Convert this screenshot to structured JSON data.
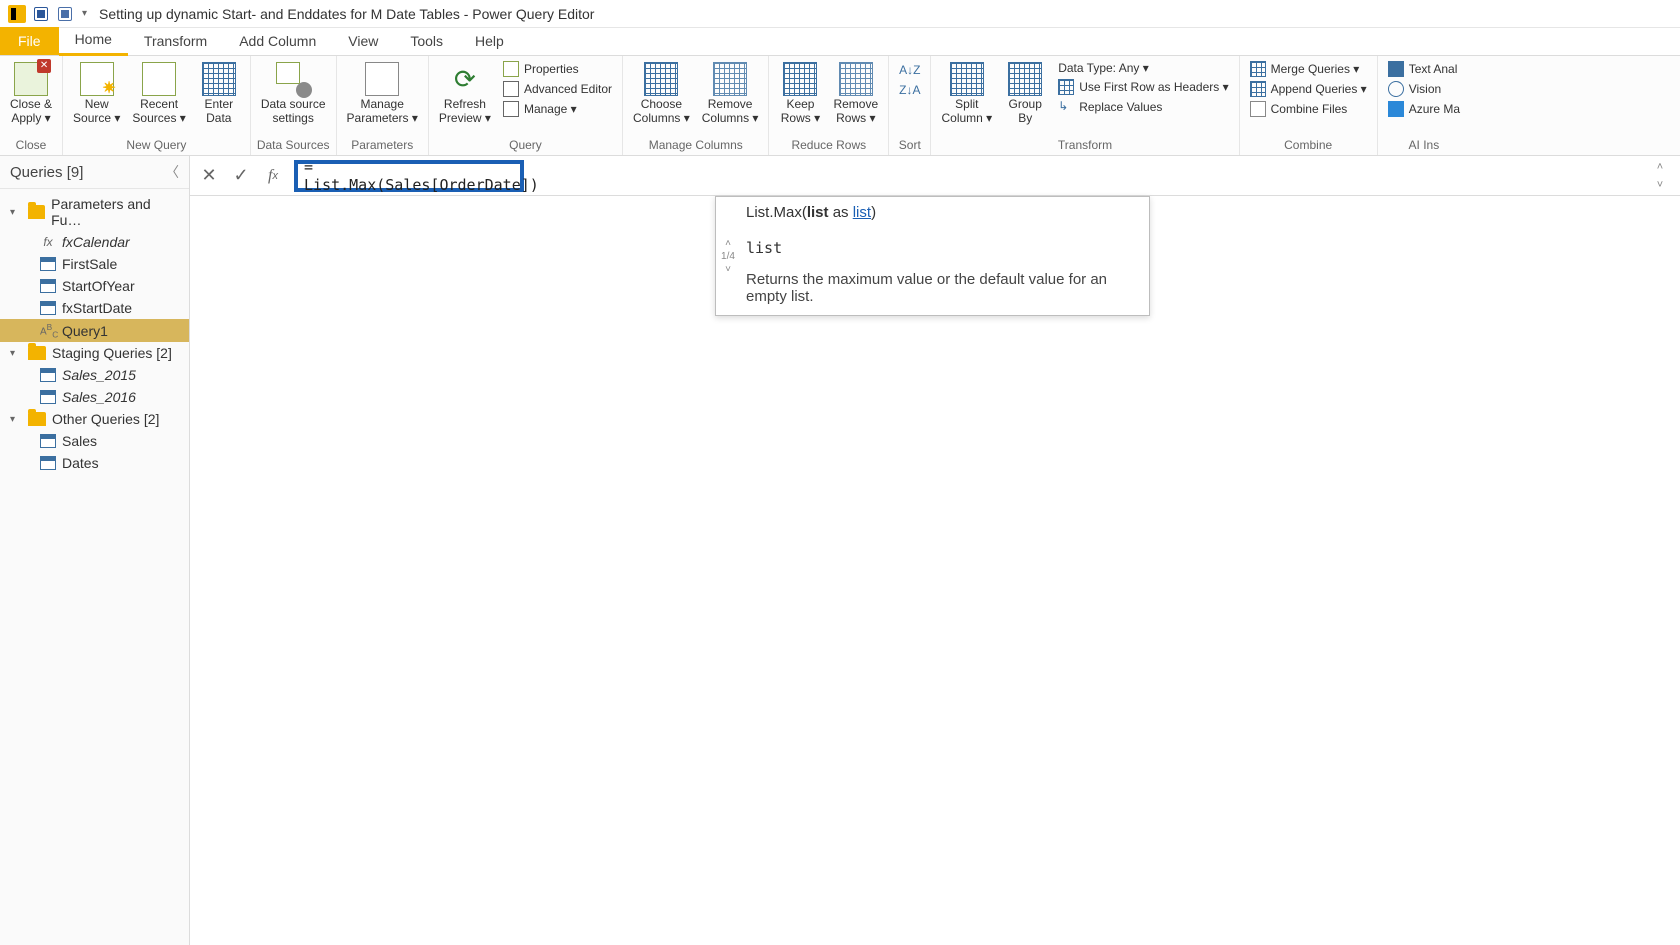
{
  "titlebar": {
    "title": "Setting up dynamic Start- and Enddates for M Date Tables - Power Query Editor"
  },
  "menu": {
    "file": "File",
    "home": "Home",
    "transform": "Transform",
    "add_column": "Add Column",
    "view": "View",
    "tools": "Tools",
    "help": "Help"
  },
  "ribbon": {
    "close": {
      "close_apply": "Close &\nApply ▾",
      "group": "Close"
    },
    "newquery": {
      "new_source": "New\nSource ▾",
      "recent_sources": "Recent\nSources ▾",
      "enter_data": "Enter\nData",
      "group": "New Query"
    },
    "datasources": {
      "settings": "Data source\nsettings",
      "group": "Data Sources"
    },
    "parameters": {
      "manage": "Manage\nParameters ▾",
      "group": "Parameters"
    },
    "query": {
      "refresh": "Refresh\nPreview ▾",
      "properties": "Properties",
      "advanced": "Advanced Editor",
      "manage": "Manage ▾",
      "group": "Query"
    },
    "managecols": {
      "choose": "Choose\nColumns ▾",
      "remove": "Remove\nColumns ▾",
      "group": "Manage Columns"
    },
    "reducerows": {
      "keep": "Keep\nRows ▾",
      "remove": "Remove\nRows ▾",
      "group": "Reduce Rows"
    },
    "sort": {
      "group": "Sort"
    },
    "transform": {
      "split": "Split\nColumn ▾",
      "groupby": "Group\nBy",
      "datatype": "Data Type: Any ▾",
      "firstrow": "Use First Row as Headers ▾",
      "replace": "Replace Values",
      "group": "Transform"
    },
    "combine": {
      "merge": "Merge Queries ▾",
      "append": "Append Queries ▾",
      "combine": "Combine Files",
      "group": "Combine"
    },
    "ai": {
      "text": "Text Anal",
      "vision": "Vision",
      "azure": "Azure Ma",
      "group": "AI Ins"
    }
  },
  "queriesPanel": {
    "header": "Queries [9]",
    "group_params": "Parameters and Fu…",
    "fxCalendar": "fxCalendar",
    "FirstSale": "FirstSale",
    "StartOfYear": "StartOfYear",
    "fxStartDate": "fxStartDate",
    "Query1": "Query1",
    "group_staging": "Staging Queries [2]",
    "Sales_2015": "Sales_2015",
    "Sales_2016": "Sales_2016",
    "group_other": "Other Queries [2]",
    "Sales": "Sales",
    "Dates": "Dates"
  },
  "formula": {
    "text": "= List.Max(Sales[OrderDate])"
  },
  "tooltip": {
    "sig_pre": "List.Max(",
    "sig_arg": "list",
    "sig_as": " as ",
    "sig_type": "list",
    "sig_post": ")",
    "counter": "1/4",
    "param": "list",
    "desc": "Returns the maximum value or the default value for an empty list."
  }
}
